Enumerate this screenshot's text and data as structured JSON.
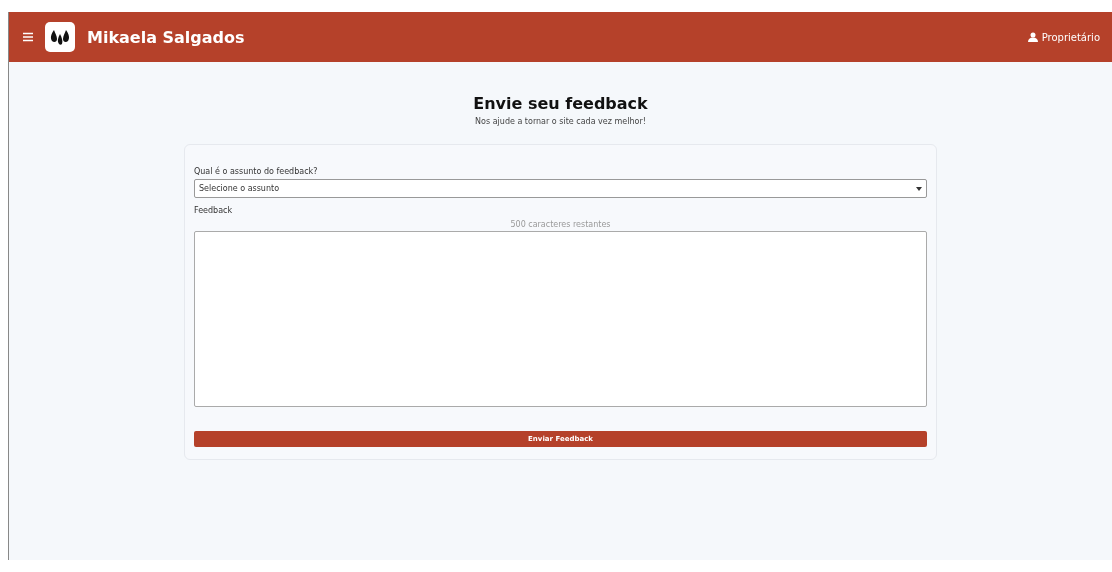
{
  "header": {
    "brand": "Mikaela Salgados",
    "user": "Proprietário"
  },
  "page": {
    "title": "Envie seu feedback",
    "subtitle": "Nos ajude a tornar o site cada vez melhor!"
  },
  "form": {
    "subject_label": "Qual é o assunto do feedback?",
    "subject_value": "Selecione o assunto",
    "feedback_label": "Feedback",
    "counter": "500 caracteres restantes",
    "submit": "Enviar Feedback"
  }
}
